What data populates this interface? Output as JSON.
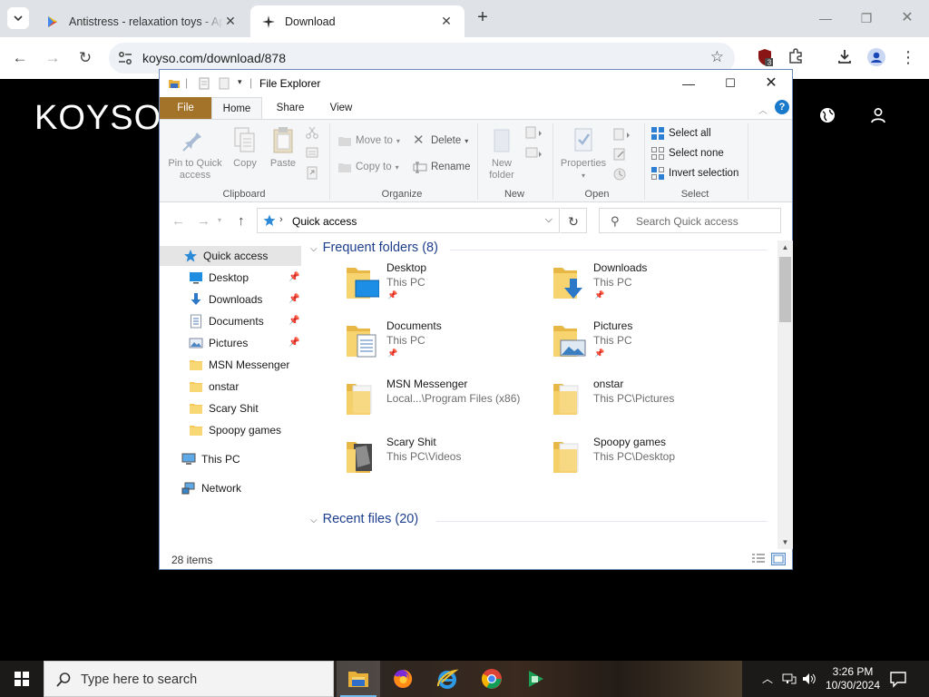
{
  "browser": {
    "tabs": [
      {
        "title": "Antistress - relaxation toys - Ap",
        "active": false
      },
      {
        "title": "Download",
        "active": true
      }
    ],
    "url": "koyso.com/download/878",
    "extension_badge": "3"
  },
  "website": {
    "logo": "KOYSO"
  },
  "explorer": {
    "title": "File Explorer",
    "ribbon_tabs": {
      "file": "File",
      "home": "Home",
      "share": "Share",
      "view": "View"
    },
    "clipboard": {
      "pin": "Pin to Quick access",
      "copy": "Copy",
      "paste": "Paste",
      "label": "Clipboard"
    },
    "organize": {
      "move_to": "Move to",
      "copy_to": "Copy to",
      "delete": "Delete",
      "rename": "Rename",
      "label": "Organize"
    },
    "new_group": {
      "new_folder": "New folder",
      "label": "New"
    },
    "open_group": {
      "properties": "Properties",
      "label": "Open"
    },
    "select_group": {
      "select_all": "Select all",
      "select_none": "Select none",
      "invert": "Invert selection",
      "label": "Select"
    },
    "address": "Quick access",
    "search_placeholder": "Search Quick access",
    "nav": {
      "quick_access": "Quick access",
      "pinned": [
        {
          "label": "Desktop"
        },
        {
          "label": "Downloads"
        },
        {
          "label": "Documents"
        },
        {
          "label": "Pictures"
        },
        {
          "label": "MSN Messenger"
        },
        {
          "label": "onstar"
        },
        {
          "label": "Scary Shit"
        },
        {
          "label": "Spoopy games"
        }
      ],
      "this_pc": "This PC",
      "network": "Network"
    },
    "frequent_header": "Frequent folders (8)",
    "recent_header": "Recent files (20)",
    "folders": [
      {
        "name": "Desktop",
        "location": "This PC",
        "pinned": true
      },
      {
        "name": "Downloads",
        "location": "This PC",
        "pinned": true
      },
      {
        "name": "Documents",
        "location": "This PC",
        "pinned": true
      },
      {
        "name": "Pictures",
        "location": "This PC",
        "pinned": true
      },
      {
        "name": "MSN Messenger",
        "location": "Local...\\Program Files (x86)",
        "pinned": false
      },
      {
        "name": "onstar",
        "location": "This PC\\Pictures",
        "pinned": false
      },
      {
        "name": "Scary Shit",
        "location": "This PC\\Videos",
        "pinned": false
      },
      {
        "name": "Spoopy games",
        "location": "This PC\\Desktop",
        "pinned": false
      }
    ],
    "status": "28 items"
  },
  "taskbar": {
    "search_placeholder": "Type here to search",
    "time": "3:26 PM",
    "date": "10/30/2024"
  },
  "colors": {
    "file_tab": "#a4732a",
    "folder_yellow": "#f4c95d",
    "link_blue": "#1e3f8e",
    "taskbar": "#1b1a18"
  }
}
